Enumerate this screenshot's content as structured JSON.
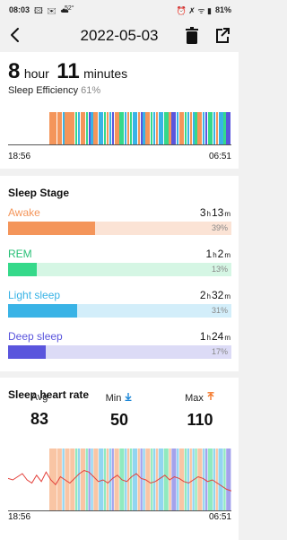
{
  "status": {
    "time": "08:03",
    "temp": "52°",
    "battery": "81%"
  },
  "toolbar": {
    "title": "2022-05-03",
    "back_icon": "back-chevron-icon",
    "delete_icon": "trash-icon",
    "share_icon": "share-icon"
  },
  "summary": {
    "hours": "8",
    "hour_unit": "hour",
    "minutes": "11",
    "minute_unit": "minutes",
    "efficiency_label": "Sleep Efficiency",
    "efficiency_value": "61%",
    "start_time": "18:56",
    "end_time": "06:51"
  },
  "timeline_segments": [
    {
      "stage": "awake",
      "w": 3
    },
    {
      "stage": "awake",
      "w": 2
    },
    {
      "stage": "light",
      "w": 1
    },
    {
      "stage": "awake",
      "w": 2
    },
    {
      "stage": "awake",
      "w": 2
    },
    {
      "stage": "rem",
      "w": 1
    },
    {
      "stage": "light",
      "w": 1
    },
    {
      "stage": "awake",
      "w": 2
    },
    {
      "stage": "rem",
      "w": 1
    },
    {
      "stage": "deep",
      "w": 1
    },
    {
      "stage": "light",
      "w": 1
    },
    {
      "stage": "awake",
      "w": 2
    },
    {
      "stage": "light",
      "w": 2
    },
    {
      "stage": "rem",
      "w": 1
    },
    {
      "stage": "awake",
      "w": 1
    },
    {
      "stage": "light",
      "w": 1
    },
    {
      "stage": "deep",
      "w": 1
    },
    {
      "stage": "awake",
      "w": 2
    },
    {
      "stage": "rem",
      "w": 2
    },
    {
      "stage": "light",
      "w": 1
    },
    {
      "stage": "awake",
      "w": 1
    },
    {
      "stage": "rem",
      "w": 1
    },
    {
      "stage": "light",
      "w": 2
    },
    {
      "stage": "awake",
      "w": 1
    },
    {
      "stage": "deep",
      "w": 1
    },
    {
      "stage": "light",
      "w": 1
    },
    {
      "stage": "awake",
      "w": 2
    },
    {
      "stage": "rem",
      "w": 1
    },
    {
      "stage": "light",
      "w": 1
    },
    {
      "stage": "awake",
      "w": 1
    },
    {
      "stage": "light",
      "w": 2
    },
    {
      "stage": "rem",
      "w": 2
    },
    {
      "stage": "awake",
      "w": 1
    },
    {
      "stage": "deep",
      "w": 2
    },
    {
      "stage": "light",
      "w": 1
    },
    {
      "stage": "awake",
      "w": 2
    },
    {
      "stage": "rem",
      "w": 1
    },
    {
      "stage": "light",
      "w": 1
    },
    {
      "stage": "awake",
      "w": 1
    },
    {
      "stage": "light",
      "w": 1
    },
    {
      "stage": "rem",
      "w": 1
    },
    {
      "stage": "awake",
      "w": 2
    },
    {
      "stage": "light",
      "w": 1
    },
    {
      "stage": "deep",
      "w": 1
    },
    {
      "stage": "rem",
      "w": 2
    },
    {
      "stage": "light",
      "w": 1
    },
    {
      "stage": "awake",
      "w": 1
    },
    {
      "stage": "light",
      "w": 2
    },
    {
      "stage": "rem",
      "w": 1
    },
    {
      "stage": "deep",
      "w": 2
    }
  ],
  "stage_title": "Sleep Stage",
  "stages": [
    {
      "name": "Awake",
      "h": "3",
      "m": "13",
      "h_unit": "h",
      "m_unit": "m",
      "percent": "39%",
      "fraction": 0.39,
      "color": "#f4955a",
      "light": "#fbe3d5",
      "text_color": "#f4955a"
    },
    {
      "name": "REM",
      "h": "1",
      "m": "2",
      "h_unit": "h",
      "m_unit": "m",
      "percent": "13%",
      "fraction": 0.13,
      "color": "#35d98a",
      "light": "#d5f6e4",
      "text_color": "#28c077"
    },
    {
      "name": "Light sleep",
      "h": "2",
      "m": "32",
      "h_unit": "h",
      "m_unit": "m",
      "percent": "31%",
      "fraction": 0.31,
      "color": "#39b3e6",
      "light": "#d3eefa",
      "text_color": "#39b3e6"
    },
    {
      "name": "Deep sleep",
      "h": "1",
      "m": "24",
      "h_unit": "h",
      "m_unit": "m",
      "percent": "17%",
      "fraction": 0.17,
      "color": "#5a55dd",
      "light": "#dcdbf6",
      "text_color": "#5a55dd"
    }
  ],
  "heart": {
    "title": "Sleep heart rate",
    "avg_label": "Avg",
    "avg": "83",
    "min_label": "Min",
    "min": "50",
    "max_label": "Max",
    "max": "110",
    "min_icon": "arrow-down-icon",
    "max_icon": "arrow-up-icon",
    "start_time": "18:56",
    "end_time": "06:51",
    "series": [
      81,
      80,
      82,
      84,
      80,
      78,
      83,
      79,
      85,
      80,
      77,
      82,
      80,
      78,
      81,
      84,
      86,
      85,
      82,
      79,
      80,
      78,
      81,
      83,
      80,
      79,
      82,
      84,
      81,
      80,
      78,
      79,
      81,
      83,
      80,
      82,
      81,
      79,
      78,
      80,
      82,
      81,
      79,
      80,
      78,
      76,
      74,
      73
    ]
  },
  "colors": {
    "awake": "#f4955a",
    "rem": "#35d98a",
    "light": "#39b3e6",
    "deep": "#5a55dd",
    "min_accent": "#1e88d8",
    "max_accent": "#f4782a",
    "heart_line": "#e3403a"
  }
}
